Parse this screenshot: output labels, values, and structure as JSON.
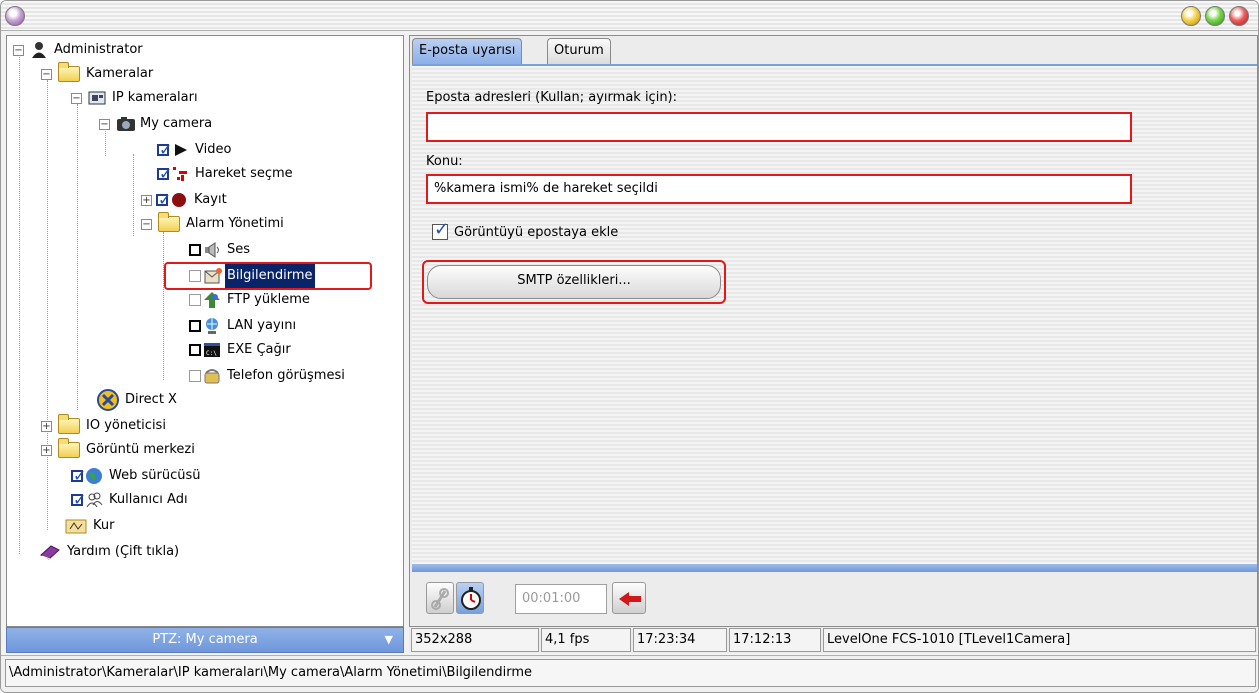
{
  "window": {
    "traffic_lights": [
      "yellow",
      "green",
      "red"
    ]
  },
  "tree": {
    "items": [
      {
        "label": "Administrator",
        "icon": "admin-icon"
      },
      {
        "label": "Kameralar",
        "icon": "folder-open-icon"
      },
      {
        "label": "IP kameraları",
        "icon": "ip-cameras-icon"
      },
      {
        "label": "My camera",
        "icon": "camera-icon"
      },
      {
        "label": "Video",
        "icon": "play-icon",
        "checked": true
      },
      {
        "label": "Hareket seçme",
        "icon": "motion-icon",
        "checked": true
      },
      {
        "label": "Kayıt",
        "icon": "record-icon",
        "checked": true
      },
      {
        "label": "Alarm Yönetimi",
        "icon": "folder-open-icon"
      },
      {
        "label": "Ses",
        "icon": "speaker-icon",
        "checked": false
      },
      {
        "label": "Bilgilendirme",
        "icon": "notify-icon",
        "checked": false,
        "selected": true
      },
      {
        "label": "FTP yükleme",
        "icon": "ftp-icon",
        "checked": false
      },
      {
        "label": "LAN yayını",
        "icon": "lan-icon",
        "checked": false
      },
      {
        "label": "EXE Çağır",
        "icon": "exe-icon",
        "checked": false
      },
      {
        "label": "Telefon görüşmesi",
        "icon": "phone-icon",
        "checked": false
      },
      {
        "label": "Direct X",
        "icon": "directx-icon"
      },
      {
        "label": "IO yöneticisi",
        "icon": "folder-icon"
      },
      {
        "label": "Görüntü merkezi",
        "icon": "folder-icon"
      },
      {
        "label": "Web sürücüsü",
        "icon": "globe-icon",
        "checked": true
      },
      {
        "label": "Kullanıcı Adı",
        "icon": "users-icon",
        "checked": true
      },
      {
        "label": "Kur",
        "icon": "setup-icon"
      },
      {
        "label": "Yardım (Çift tıkla)",
        "icon": "help-book-icon"
      }
    ]
  },
  "ptz": {
    "label": "PTZ: My camera"
  },
  "tabs": [
    {
      "label": "E-posta uyarısı",
      "active": true
    },
    {
      "label": "Oturum",
      "active": false
    }
  ],
  "email_form": {
    "addresses_label": "Eposta adresleri (Kullan; ayırmak için):",
    "addresses_value": "",
    "subject_label": "Konu:",
    "subject_value": "%kamera ismi% de hareket seçildi",
    "attach_label": "Görüntüyü epostaya ekle",
    "attach_checked": true,
    "smtp_button": "SMTP özellikleri..."
  },
  "toolbar": {
    "timer_value": "00:01:00"
  },
  "status": {
    "resolution": "352x288",
    "fps": "4,1 fps",
    "time1": "17:23:34",
    "time2": "17:12:13",
    "camera": "LevelOne FCS-1010 [TLevel1Camera]"
  },
  "path": {
    "text": "\\Administrator\\Kameralar\\IP kameraları\\My camera\\Alarm Yönetimi\\Bilgilendirme"
  },
  "colors": {
    "highlight": "#e01a1a",
    "selection": "#0a246a",
    "tab_active": "#8cb0e8"
  }
}
